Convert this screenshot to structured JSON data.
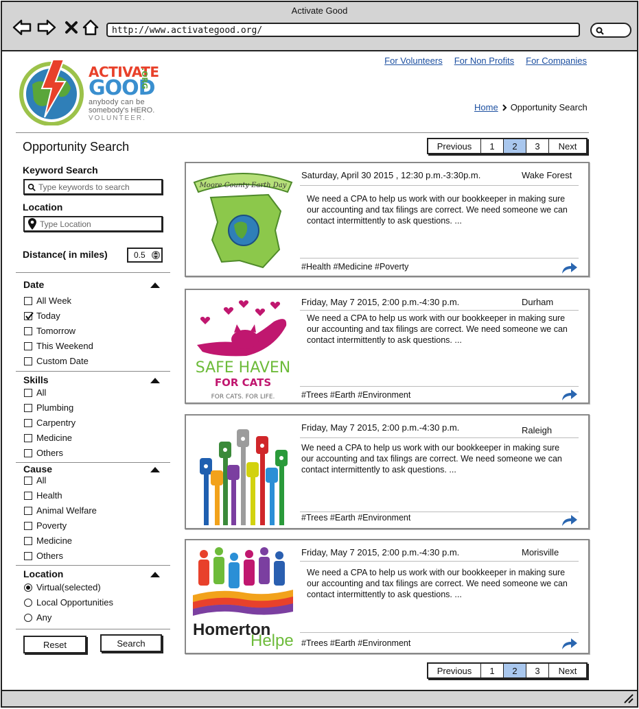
{
  "window": {
    "title": "Activate Good",
    "url": "http://www.activategood.org/"
  },
  "logo": {
    "line1": "ACTIVATE",
    "line2": "GOOD",
    "tld": ".ORG",
    "tagline1": "anybody can be",
    "tagline2": "somebody's HERO.",
    "tagline3": "VOLUNTEER."
  },
  "top_links": [
    "For Volunteers",
    "For Non Profits",
    "For Companies"
  ],
  "breadcrumb": {
    "home": "Home",
    "current": "Opportunity Search"
  },
  "page_title": "Opportunity Search",
  "pager": {
    "prev": "Previous",
    "pages": [
      "1",
      "2",
      "3"
    ],
    "active": "2",
    "next": "Next"
  },
  "filters": {
    "keyword_label": "Keyword Search",
    "keyword_placeholder": "Type keywords to search",
    "location_label": "Location",
    "location_placeholder": "Type Location",
    "distance_label": "Distance( in miles)",
    "distance_value": "0.5",
    "date": {
      "title": "Date",
      "options": [
        "All Week",
        "Today",
        "Tomorrow",
        "This Weekend",
        "Custom Date"
      ],
      "checked": "Today"
    },
    "skills": {
      "title": "Skills",
      "options": [
        "All",
        "Plumbing",
        "Carpentry",
        "Medicine",
        "Others"
      ]
    },
    "cause": {
      "title": "Cause",
      "options": [
        "All",
        "Health",
        "Animal Welfare",
        "Poverty",
        "Medicine",
        "Others"
      ]
    },
    "location_type": {
      "title": "Location",
      "options": [
        "Virtual(selected)",
        "Local Opportunities",
        "Any"
      ],
      "selected": "Virtual(selected)"
    },
    "reset": "Reset",
    "search": "Search"
  },
  "opportunities": [
    {
      "date": "Saturday, April 30 2015 , 12:30 p.m.-3:30p.m.",
      "location": "Wake Forest",
      "description": "We need a CPA to help us work with our bookkeeper in making sure our accounting and tax filings are correct. We need someone we can contact intermittently to ask questions. ...",
      "tags": "#Health #Medicine #Poverty",
      "org_image": "Moore County Earth Day",
      "image_label": "Moore County Earth Day"
    },
    {
      "date": "Friday, May 7 2015, 2:00 p.m.-4:30 p.m.",
      "location": "Durham",
      "description": "We need a CPA to help us work with our bookkeeper in making sure our accounting and tax filings are correct. We need someone we can contact intermittently to ask questions. ...",
      "tags": "#Trees #Earth #Environment",
      "org_image": "Safe Haven for Cats",
      "image_line1": "SAFE HAVEN",
      "image_line2": "FOR CATS",
      "image_line3": "FOR CATS. FOR LIFE."
    },
    {
      "date": "Friday, May 7 2015, 2:00 p.m.-4:30 p.m.",
      "location": "Raleigh",
      "description": "We need a CPA to help us work with our bookkeeper in making sure our accounting and tax filings are correct. We need someone we can contact intermittently to ask questions. ...",
      "tags": "#Trees #Earth #Environment",
      "org_image": "raised hands"
    },
    {
      "date": "Friday, May 7 2015, 2:00 p.m.-4:30 p.m.",
      "location": "Morisville",
      "description": "We need a CPA to help us work with our bookkeeper in making sure our accounting and tax filings are correct. We need someone we can contact intermittently to ask questions. ...",
      "tags": "#Trees #Earth #Environment",
      "org_image": "Homerton Helpers",
      "image_line1": "Homerton",
      "image_line2": "Helpers"
    }
  ],
  "colors": {
    "link": "#1c4fa0",
    "pager_active": "#a9c7ee",
    "chrome": "#d4d4d4",
    "share": "#2a66b0",
    "logo_red": "#e8412b",
    "logo_green": "#5aa63a",
    "logo_blue": "#3a8fcf"
  }
}
